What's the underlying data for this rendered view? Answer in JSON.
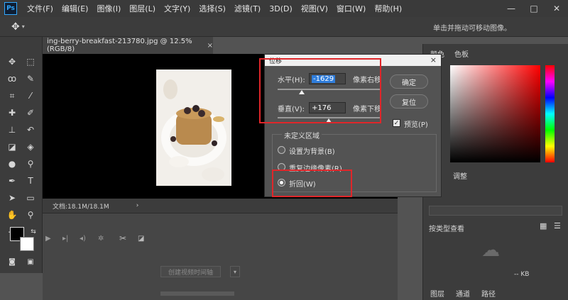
{
  "app": {
    "logo": "Ps"
  },
  "menu": [
    "文件(F)",
    "编辑(E)",
    "图像(I)",
    "图层(L)",
    "文字(Y)",
    "选择(S)",
    "滤镜(T)",
    "3D(D)",
    "视图(V)",
    "窗口(W)",
    "帮助(H)"
  ],
  "window_controls": {
    "minimize": "—",
    "maximize": "□",
    "close": "✕"
  },
  "options_bar": {
    "hint": "单击并拖动可移动图像。",
    "tool_icon": "move-icon"
  },
  "document": {
    "tab_title": "ing-berry-breakfast-213780.jpg @ 12.5%(RGB/8)",
    "tab_close": "×",
    "status": "文档:18.1M/18.1M",
    "status_arrow": "›"
  },
  "timeline": {
    "create_button": "创建视频时间轴",
    "scissor": "✂"
  },
  "right_panels": {
    "top_tabs": [
      "颜色",
      "色板"
    ],
    "mid_tabs": [
      "调整"
    ],
    "filter_label": "按类型查看",
    "size_label": "-- KB",
    "bottom_tabs": [
      "图层",
      "通道",
      "路径"
    ]
  },
  "dialog": {
    "title": "位移",
    "close": "×",
    "horizontal": {
      "label": "水平(H):",
      "value": "-1629",
      "unit": "像素右移"
    },
    "vertical": {
      "label": "垂直(V):",
      "value": "+176",
      "unit": "像素下移"
    },
    "buttons": {
      "ok": "确定",
      "reset": "复位"
    },
    "preview": {
      "label": "预览(P)",
      "checked": true
    },
    "undefined_area": {
      "title": "未定义区域",
      "options": [
        {
          "label": "设置为背景(B)",
          "selected": false
        },
        {
          "label": "重复边缘像素(R)",
          "selected": false
        },
        {
          "label": "折回(W)",
          "selected": true
        }
      ]
    }
  },
  "highlight_color": "#e0262a",
  "selection_color": "#2f7ddb"
}
